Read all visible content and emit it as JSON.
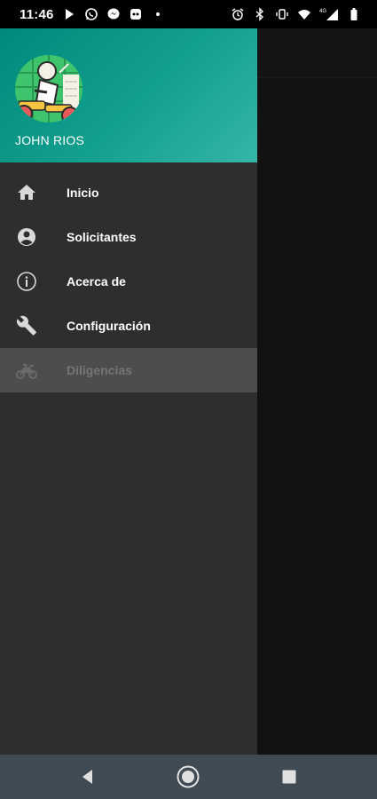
{
  "status_bar": {
    "time": "11:46",
    "left_icons": [
      "play-icon",
      "whatsapp-icon",
      "messenger-icon",
      "app-icon",
      "dot-icon"
    ],
    "right_icons": [
      "alarm-icon",
      "bluetooth-icon",
      "vibrate-icon",
      "wifi-icon",
      "signal-icon",
      "battery-icon"
    ],
    "network": "4G"
  },
  "drawer": {
    "user_name": "JOHN RIOS",
    "avatar_icon": "motorcycle-courier-avatar",
    "menu": [
      {
        "label": "Inicio",
        "icon": "home-icon"
      },
      {
        "label": "Solicitantes",
        "icon": "account-circle-icon"
      },
      {
        "label": "Acerca de",
        "icon": "info-icon"
      },
      {
        "label": "Configuración",
        "icon": "wrench-icon"
      },
      {
        "label": "Diligencias",
        "icon": "motorcycle-icon",
        "selected": true
      }
    ],
    "colors": {
      "header_start": "#00897b",
      "header_end": "#36b5a6",
      "drawer_bg": "#2e2e2e",
      "selected_bg": "#4d4d4d"
    }
  },
  "nav_bar": {
    "buttons": [
      "back-icon",
      "home-circle-icon",
      "recents-icon"
    ]
  }
}
